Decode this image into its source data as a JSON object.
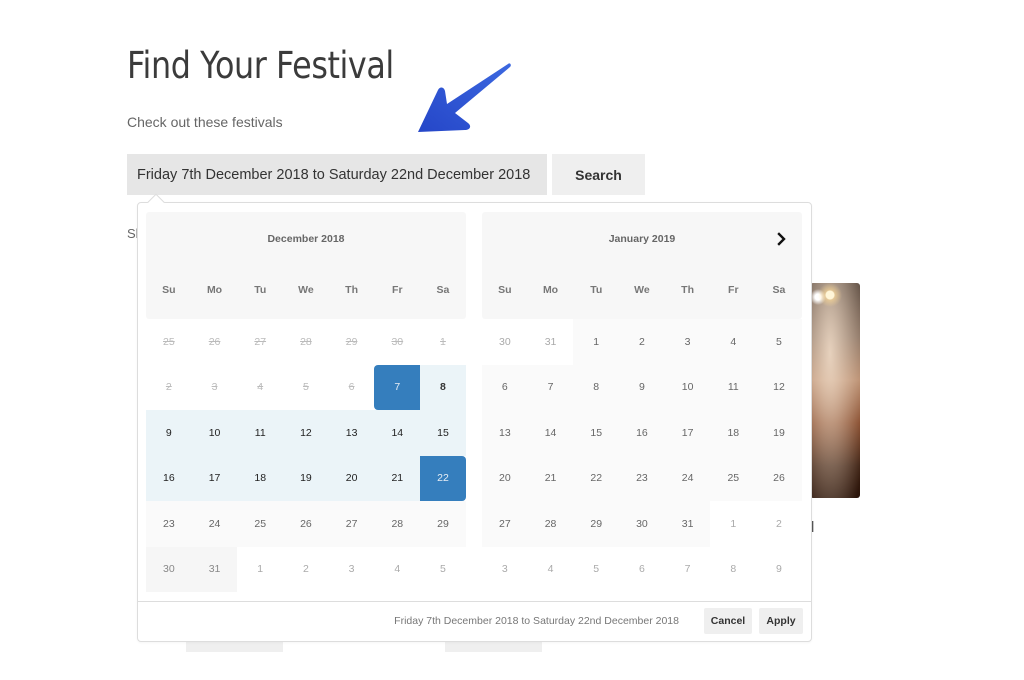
{
  "page": {
    "title": "Find Your Festival",
    "subtitle": "Check out these festivals",
    "peek_text": "Sh",
    "peek_letter": "l"
  },
  "search": {
    "date_range_value": "Friday 7th December 2018 to Saturday 22nd December 2018",
    "button_label": "Search"
  },
  "colors": {
    "selected": "#357ebd",
    "in_range": "#ebf4f8",
    "arrow": "#2f55d4"
  },
  "picker": {
    "weekdays": [
      "Su",
      "Mo",
      "Tu",
      "We",
      "Th",
      "Fr",
      "Sa"
    ],
    "next_icon": "chevron-right-icon",
    "selected_start": "7",
    "selected_end": "22",
    "left": {
      "month_title": "December 2018",
      "weeks": [
        [
          {
            "d": "25",
            "s": "disabled"
          },
          {
            "d": "26",
            "s": "disabled"
          },
          {
            "d": "27",
            "s": "disabled"
          },
          {
            "d": "28",
            "s": "disabled"
          },
          {
            "d": "29",
            "s": "disabled"
          },
          {
            "d": "30",
            "s": "disabled"
          },
          {
            "d": "1",
            "s": "disabled"
          }
        ],
        [
          {
            "d": "2",
            "s": "disabled"
          },
          {
            "d": "3",
            "s": "disabled"
          },
          {
            "d": "4",
            "s": "disabled"
          },
          {
            "d": "5",
            "s": "disabled"
          },
          {
            "d": "6",
            "s": "disabled"
          },
          {
            "d": "7",
            "s": "selected start"
          },
          {
            "d": "8",
            "s": "in-range bold"
          }
        ],
        [
          {
            "d": "9",
            "s": "in-range"
          },
          {
            "d": "10",
            "s": "in-range"
          },
          {
            "d": "11",
            "s": "in-range"
          },
          {
            "d": "12",
            "s": "in-range"
          },
          {
            "d": "13",
            "s": "in-range"
          },
          {
            "d": "14",
            "s": "in-range"
          },
          {
            "d": "15",
            "s": "in-range"
          }
        ],
        [
          {
            "d": "16",
            "s": "in-range"
          },
          {
            "d": "17",
            "s": "in-range"
          },
          {
            "d": "18",
            "s": "in-range"
          },
          {
            "d": "19",
            "s": "in-range"
          },
          {
            "d": "20",
            "s": "in-range"
          },
          {
            "d": "21",
            "s": "in-range"
          },
          {
            "d": "22",
            "s": "selected end"
          }
        ],
        [
          {
            "d": "23",
            "s": ""
          },
          {
            "d": "24",
            "s": ""
          },
          {
            "d": "25",
            "s": ""
          },
          {
            "d": "26",
            "s": ""
          },
          {
            "d": "27",
            "s": ""
          },
          {
            "d": "28",
            "s": ""
          },
          {
            "d": "29",
            "s": ""
          }
        ],
        [
          {
            "d": "30",
            "s": "off-shade"
          },
          {
            "d": "31",
            "s": "off-shade"
          },
          {
            "d": "1",
            "s": "off"
          },
          {
            "d": "2",
            "s": "off"
          },
          {
            "d": "3",
            "s": "off"
          },
          {
            "d": "4",
            "s": "off"
          },
          {
            "d": "5",
            "s": "off"
          }
        ]
      ]
    },
    "right": {
      "month_title": "January 2019",
      "weeks": [
        [
          {
            "d": "30",
            "s": "off"
          },
          {
            "d": "31",
            "s": "off"
          },
          {
            "d": "1",
            "s": ""
          },
          {
            "d": "2",
            "s": ""
          },
          {
            "d": "3",
            "s": ""
          },
          {
            "d": "4",
            "s": ""
          },
          {
            "d": "5",
            "s": ""
          }
        ],
        [
          {
            "d": "6",
            "s": ""
          },
          {
            "d": "7",
            "s": ""
          },
          {
            "d": "8",
            "s": ""
          },
          {
            "d": "9",
            "s": ""
          },
          {
            "d": "10",
            "s": ""
          },
          {
            "d": "11",
            "s": ""
          },
          {
            "d": "12",
            "s": ""
          }
        ],
        [
          {
            "d": "13",
            "s": ""
          },
          {
            "d": "14",
            "s": ""
          },
          {
            "d": "15",
            "s": ""
          },
          {
            "d": "16",
            "s": ""
          },
          {
            "d": "17",
            "s": ""
          },
          {
            "d": "18",
            "s": ""
          },
          {
            "d": "19",
            "s": ""
          }
        ],
        [
          {
            "d": "20",
            "s": ""
          },
          {
            "d": "21",
            "s": ""
          },
          {
            "d": "22",
            "s": ""
          },
          {
            "d": "23",
            "s": ""
          },
          {
            "d": "24",
            "s": ""
          },
          {
            "d": "25",
            "s": ""
          },
          {
            "d": "26",
            "s": ""
          }
        ],
        [
          {
            "d": "27",
            "s": ""
          },
          {
            "d": "28",
            "s": ""
          },
          {
            "d": "29",
            "s": ""
          },
          {
            "d": "30",
            "s": ""
          },
          {
            "d": "31",
            "s": ""
          },
          {
            "d": "1",
            "s": "off"
          },
          {
            "d": "2",
            "s": "off"
          }
        ],
        [
          {
            "d": "3",
            "s": "off"
          },
          {
            "d": "4",
            "s": "off"
          },
          {
            "d": "5",
            "s": "off"
          },
          {
            "d": "6",
            "s": "off"
          },
          {
            "d": "7",
            "s": "off"
          },
          {
            "d": "8",
            "s": "off"
          },
          {
            "d": "9",
            "s": "off"
          }
        ]
      ]
    },
    "footer": {
      "range_text": "Friday 7th December 2018 to Saturday 22nd December 2018",
      "cancel_label": "Cancel",
      "apply_label": "Apply"
    }
  }
}
